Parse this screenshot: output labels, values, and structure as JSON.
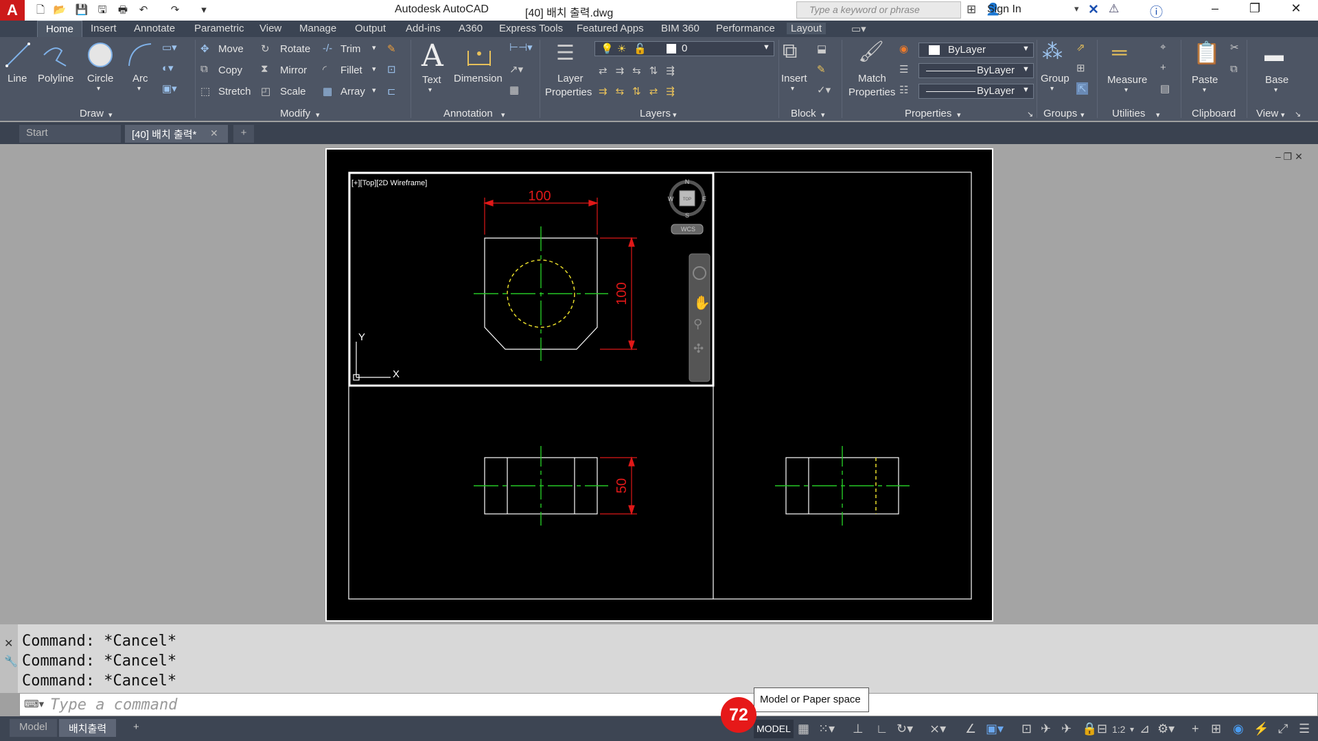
{
  "titlebar": {
    "app_title": "Autodesk AutoCAD",
    "doc_title": "[40] 배치 출력.dwg",
    "search_placeholder": "Type a keyword or phrase",
    "signin": "Sign In"
  },
  "menu_tabs": [
    "Home",
    "Insert",
    "Annotate",
    "Parametric",
    "View",
    "Manage",
    "Output",
    "Add-ins",
    "A360",
    "Express Tools",
    "Featured Apps",
    "BIM 360",
    "Performance",
    "Layout"
  ],
  "ribbon": {
    "draw": {
      "title": "Draw",
      "line": "Line",
      "polyline": "Polyline",
      "circle": "Circle",
      "arc": "Arc"
    },
    "modify": {
      "title": "Modify",
      "move": "Move",
      "rotate": "Rotate",
      "trim": "Trim",
      "copy": "Copy",
      "mirror": "Mirror",
      "fillet": "Fillet",
      "stretch": "Stretch",
      "scale": "Scale",
      "array": "Array"
    },
    "annotation": {
      "title": "Annotation",
      "text": "Text",
      "dimension": "Dimension"
    },
    "layers": {
      "title": "Layers",
      "layer_properties_1": "Layer",
      "layer_properties_2": "Properties",
      "current_layer": "0"
    },
    "block": {
      "title": "Block",
      "insert": "Insert"
    },
    "properties": {
      "title": "Properties",
      "match_1": "Match",
      "match_2": "Properties",
      "color": "ByLayer",
      "linetype": "ByLayer",
      "lineweight": "ByLayer"
    },
    "groups": {
      "title": "Groups",
      "group": "Group"
    },
    "utilities": {
      "title": "Utilities",
      "measure": "Measure"
    },
    "clipboard": {
      "title": "Clipboard",
      "paste": "Paste"
    },
    "view": {
      "title": "View",
      "base": "Base"
    }
  },
  "doc_tabs": {
    "start": "Start",
    "current": "[40] 배치 출력*"
  },
  "viewport": {
    "label": "[+][Top][2D Wireframe]",
    "dim_top": "100",
    "dim_right": "100",
    "dim_front": "50",
    "viewcube_top": "TOP",
    "compass_n": "N",
    "compass_s": "S",
    "compass_e": "E",
    "compass_w": "W",
    "wcs": "WCS",
    "axis_x": "X",
    "axis_y": "Y"
  },
  "command": {
    "history": [
      "Command: *Cancel*",
      "Command: *Cancel*",
      "Command: *Cancel*"
    ],
    "placeholder": "Type a command"
  },
  "status": {
    "layout_tabs": [
      "Model",
      "배치출력"
    ],
    "model_button": "MODEL",
    "tooltip": "Model or Paper space",
    "badge": "72",
    "scale": "1:2"
  }
}
